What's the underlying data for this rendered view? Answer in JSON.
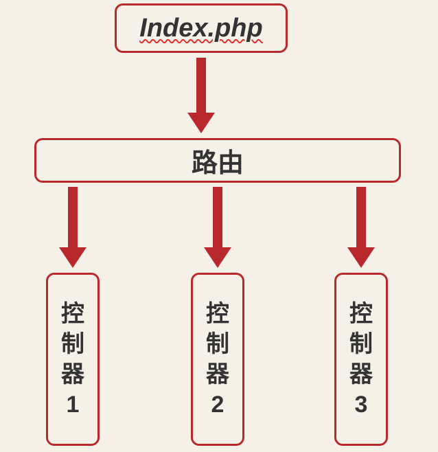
{
  "top": {
    "label": "Index.php"
  },
  "middle": {
    "label": "路由"
  },
  "controllers": [
    {
      "char1": "控",
      "char2": "制",
      "char3": "器",
      "num": "1"
    },
    {
      "char1": "控",
      "char2": "制",
      "char3": "器",
      "num": "2"
    },
    {
      "char1": "控",
      "char2": "制",
      "char3": "器",
      "num": "3"
    }
  ]
}
